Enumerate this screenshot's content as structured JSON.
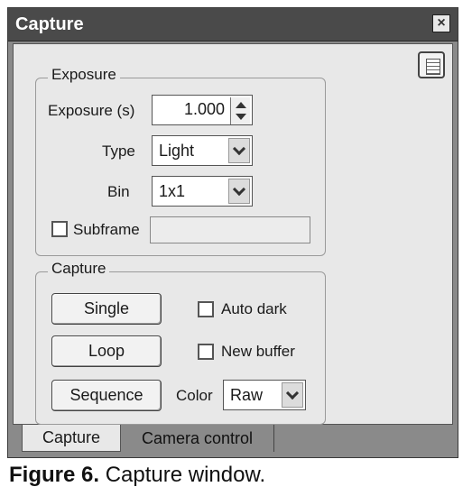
{
  "window": {
    "title": "Capture"
  },
  "exposure": {
    "legend": "Exposure",
    "exposure_label": "Exposure (s)",
    "exposure_value": "1.000",
    "type_label": "Type",
    "type_value": "Light",
    "bin_label": "Bin",
    "bin_value": "1x1",
    "subframe_label": "Subframe"
  },
  "capture": {
    "legend": "Capture",
    "single_label": "Single",
    "loop_label": "Loop",
    "sequence_label": "Sequence",
    "auto_dark_label": "Auto dark",
    "new_buffer_label": "New buffer",
    "color_label": "Color",
    "color_value": "Raw"
  },
  "tabs": [
    {
      "label": "Capture",
      "active": true
    },
    {
      "label": "Camera control",
      "active": false
    }
  ],
  "caption": {
    "figure": "Figure 6.",
    "text": " Capture window."
  },
  "icons": {
    "close": "close-icon",
    "menu": "menu-icon"
  }
}
